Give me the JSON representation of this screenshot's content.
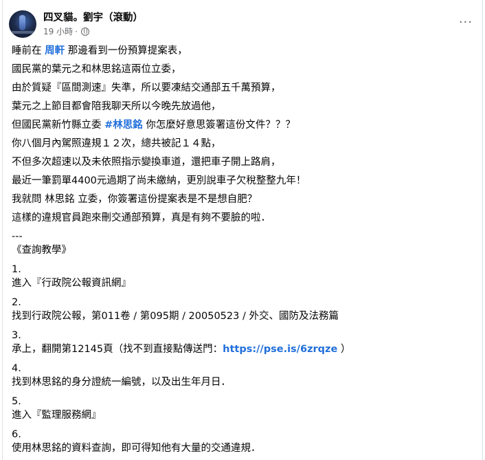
{
  "header": {
    "author": "四叉貓。劉宇（滾動）",
    "time": "19 小時",
    "more_label": "···"
  },
  "body": {
    "p1_pre": "睡前在 ",
    "p1_link": "周軒",
    "p1_post": " 那邊看到一份預算提案表，",
    "p2": "國民黨的葉元之和林思銘這兩位立委，",
    "p3": "由於質疑『區間測速』失準，所以要凍結交通部五千萬預算，",
    "p4": "葉元之上節目都會陪我聊天所以今晚先放過他，",
    "p5_pre": "但國民黨新竹縣立委 ",
    "p5_tag": "#林思銘",
    "p5_post": " 你怎麼好意思簽署這份文件？？？",
    "p6": "你八個月內駕照違規１２次，總共被記１４點，",
    "p7": "不但多次超速以及未依照指示變換車道，還把車子開上路肩，",
    "p8": "最近一筆罰單4400元過期了尚未繳納，更別說車子欠稅整整九年！",
    "p9": "我就問 林思銘 立委，你簽署這份提案表是不是想自肥？",
    "p10": "這樣的違規官員跑來刪交通部預算，真是有夠不要臉的啦．",
    "divider": "---",
    "tutorial_title": "《查詢教學》",
    "s1_num": "1.",
    "s1": "進入『行政院公報資訊網』",
    "s2_num": "2.",
    "s2": "找到行政院公報，第011卷 / 第095期 / 20050523 / 外交、國防及法務篇",
    "s3_num": "3.",
    "s3_pre": "承上，翻開第12145頁（找不到直接點傳送門：",
    "s3_link": "https://pse.is/6zrqze",
    "s3_post": " ）",
    "s4_num": "4.",
    "s4": "找到林思銘的身分證統一編號，以及出生年月日．",
    "s5_num": "5.",
    "s5": "進入『監理服務網』",
    "s6_num": "6.",
    "s6": "使用林思銘的資料查詢，即可得知他有大量的交通違規．"
  }
}
